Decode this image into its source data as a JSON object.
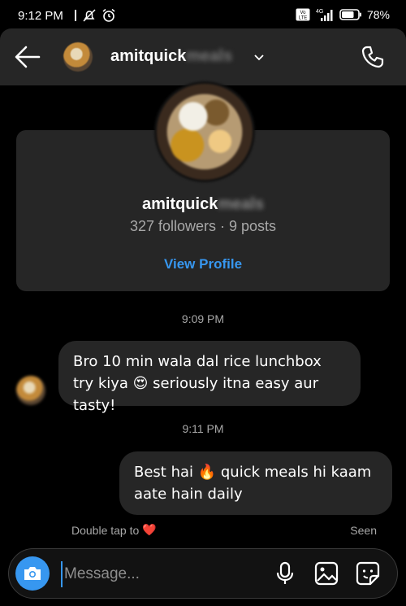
{
  "status_bar": {
    "time": "9:12 PM",
    "network": "4G",
    "volte": "VoLTE",
    "battery": "78%"
  },
  "header": {
    "username_visible": "amitquick",
    "username_blurred": "meals",
    "icons": [
      "back-arrow-icon",
      "chevron-down-icon",
      "phone-icon"
    ]
  },
  "profile_card": {
    "username_visible": "amitquick",
    "username_blurred": "meals",
    "stats": "327 followers · 9 posts",
    "view_profile_label": "View Profile"
  },
  "messages": [
    {
      "timestamp": "9:09 PM",
      "direction": "incoming",
      "text": "Bro 10 min wala dal rice lunchbox try kiya 😍 seriously itna easy aur tasty!"
    },
    {
      "timestamp": "9:11 PM",
      "direction": "outgoing",
      "text": "Best hai 🔥 quick meals hi kaam aate hain daily"
    }
  ],
  "footer": {
    "double_tap_text": "Double tap to",
    "heart": "❤️",
    "seen_label": "Seen"
  },
  "composer": {
    "placeholder": "Message...",
    "value": "",
    "icons": [
      "camera-icon",
      "microphone-icon",
      "gallery-icon",
      "sticker-icon"
    ]
  },
  "colors": {
    "accent": "#3797f0",
    "bubble": "#262626",
    "background": "#000000",
    "muted_text": "#a8a8a8"
  }
}
